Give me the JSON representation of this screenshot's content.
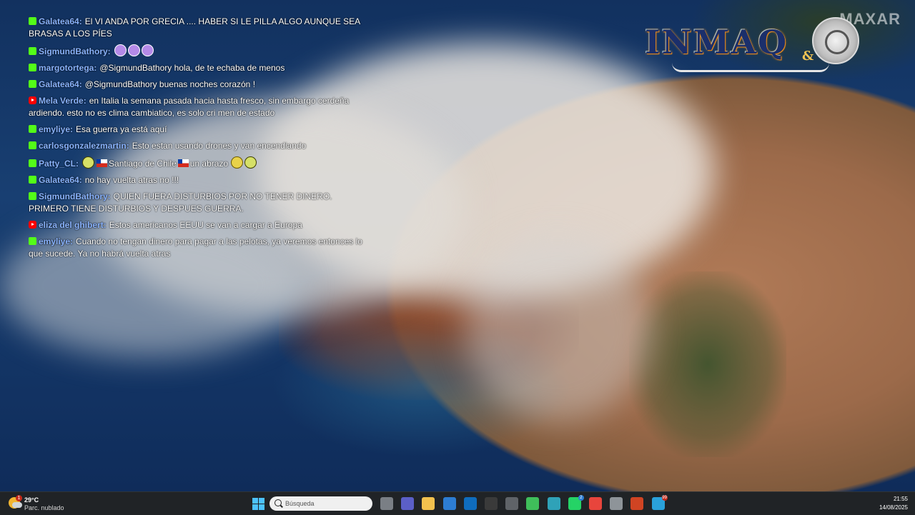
{
  "watermark": "MAXAR",
  "logo": {
    "text": "INMAQ",
    "amp": "&"
  },
  "chat": [
    {
      "source": "kick",
      "user": "Galatea64:",
      "text": "El VI ANDA POR GRECIA .... HABER SI LE PILLA ALGO AUNQUE SEA BRASAS A LOS PÍES"
    },
    {
      "source": "kick",
      "user": "SigmundBathory:",
      "text": ""
    },
    {
      "source": "kick",
      "user": "margotortega:",
      "text": "@SigmundBathory hola, de te echaba de menos"
    },
    {
      "source": "kick",
      "user": "Galatea64:",
      "text": "@SigmundBathory buenas noches corazón !"
    },
    {
      "source": "youtube",
      "user": "Mela Verde:",
      "text": "en Italia la semana pasada hacia hasta fresco, sin embargo cerdeña ardiendo. esto no es clima cambiatico, es solo cri men de estado"
    },
    {
      "source": "kick",
      "user": "emyliye:",
      "text": "Esa guerra ya está aquí"
    },
    {
      "source": "kick",
      "user": "carlosgonzalezmartin:",
      "text": "Esto estan usando drones y van encendiando"
    },
    {
      "source": "kick",
      "user": "Patty_CL:",
      "text_a": "Santiago de Chile",
      "text_b": "un abrazo"
    },
    {
      "source": "kick",
      "user": "Galatea64:",
      "text": "no hay vuelta atras no !!!"
    },
    {
      "source": "kick",
      "user": "SigmundBathory:",
      "text": "QUIEN FUERA DISTURBIOS POR NO TENER DINERO. PRIMERO TIENE DISTURBIOS Y DESPUES GUERRA."
    },
    {
      "source": "youtube",
      "user": "eliza del ghibert:",
      "text": "Estos americanos EEUU se van a cargar a Europa"
    },
    {
      "source": "kick",
      "user": "emyliye:",
      "text": "Cuando no tengan dinero para pagar a las pelotas, ya veremos entonces lo que sucede. Ya no habrá vuelta atras"
    }
  ],
  "taskbar": {
    "weather": {
      "badge": "1",
      "temp": "29°C",
      "condition": "Parc. nublado"
    },
    "search_placeholder": "Búsqueda",
    "apps": [
      {
        "name": "task-view-icon",
        "color": "#7a7f85"
      },
      {
        "name": "teams-icon",
        "color": "#5b5fc7"
      },
      {
        "name": "file-explorer-icon",
        "color": "#f2c14e"
      },
      {
        "name": "store-icon",
        "color": "#2d7dd2"
      },
      {
        "name": "outlook-icon",
        "color": "#0f6cbd"
      },
      {
        "name": "obs-icon",
        "color": "#3a3a3a"
      },
      {
        "name": "app-cube-icon",
        "color": "#5f6368"
      },
      {
        "name": "camtasia-icon",
        "color": "#3fbf5a"
      },
      {
        "name": "edge-icon",
        "color": "#2fa2b8"
      },
      {
        "name": "whatsapp-icon",
        "color": "#25d366"
      },
      {
        "name": "chrome-icon",
        "color": "#e8453c"
      },
      {
        "name": "security-icon",
        "color": "#8e9499"
      },
      {
        "name": "powerpoint-icon",
        "color": "#d04423"
      },
      {
        "name": "telegram-icon",
        "color": "#2aa1da"
      }
    ],
    "badges": {
      "whatsapp": "2",
      "telegram": "99"
    },
    "clock": {
      "time": "21:55",
      "date": "14/08/2025"
    }
  },
  "colors": {
    "taskbar": "#202326",
    "username": "#8ab4ff",
    "kick": "#53fc18",
    "youtube": "#ff0000",
    "smoke": "#e8e4e0",
    "land": "#a7714f"
  }
}
